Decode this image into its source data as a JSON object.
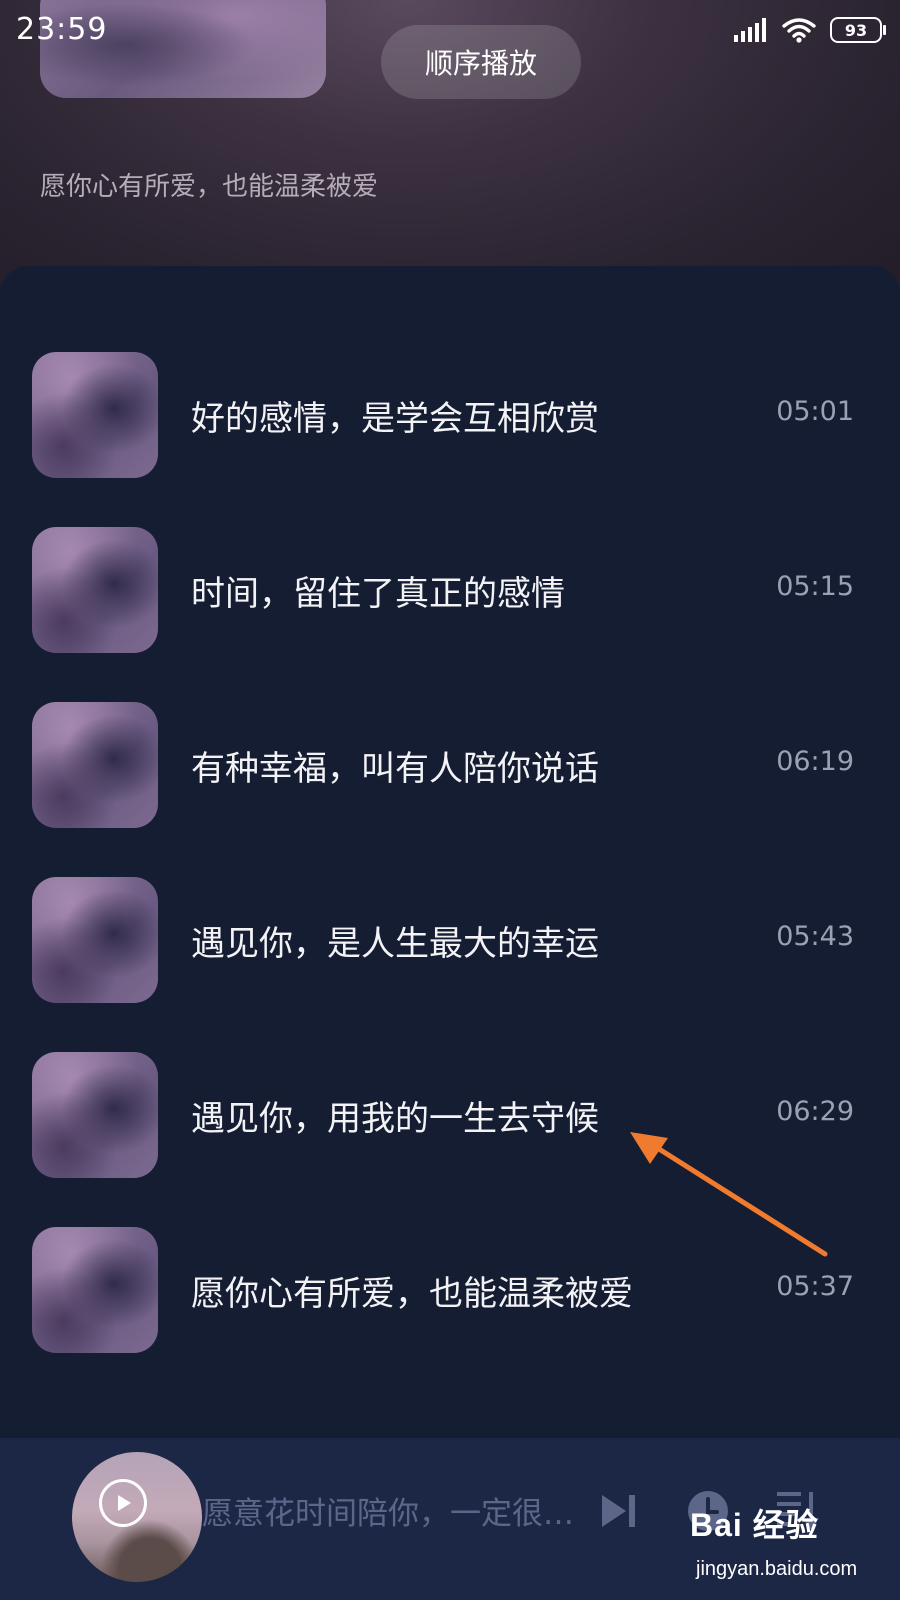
{
  "status_bar": {
    "time": "23:59",
    "battery": "93"
  },
  "header": {
    "play_mode_label": "顺序播放",
    "subtitle": "愿你心有所爱，也能温柔被爱"
  },
  "tracks": [
    {
      "title": "好的感情，是学会互相欣赏",
      "duration": "05:01"
    },
    {
      "title": "时间，留住了真正的感情",
      "duration": "05:15"
    },
    {
      "title": "有种幸福，叫有人陪你说话",
      "duration": "06:19"
    },
    {
      "title": "遇见你，是人生最大的幸运",
      "duration": "05:43"
    },
    {
      "title": "遇见你，用我的一生去守候",
      "duration": "06:29"
    },
    {
      "title": "愿你心有所爱，也能温柔被爱",
      "duration": "05:37"
    }
  ],
  "player": {
    "now_playing": "愿意花时间陪你，一定很…",
    "icons": [
      "play-icon",
      "next-icon",
      "timer-icon",
      "playlist-icon"
    ]
  },
  "watermark": {
    "logo": "Bai 经验",
    "url": "jingyan.baidu.com"
  },
  "colors": {
    "accent_arrow": "#f07a2e",
    "panel_bg": "#151d33",
    "player_bg": "#1c2746"
  }
}
